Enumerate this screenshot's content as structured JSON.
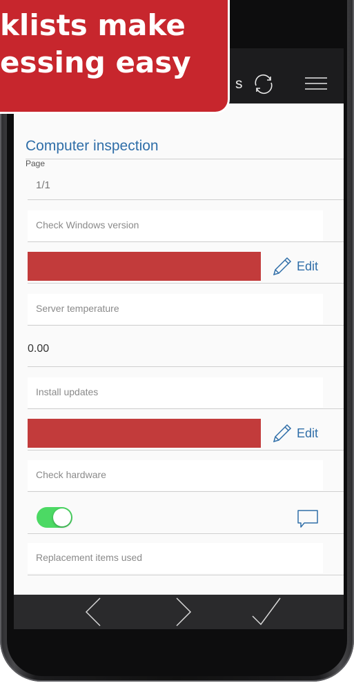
{
  "banner": {
    "line1": "klists make",
    "line2": "essing easy"
  },
  "header": {
    "partial_title": "s",
    "sync_icon": "sync-icon",
    "menu_icon": "hamburger-menu-icon"
  },
  "form": {
    "title": "Computer inspection",
    "page_label": "Page",
    "page_value": "1/1",
    "items": [
      {
        "label": "Check Windows version",
        "edit_label": "Edit",
        "status_color": "#c23b3b"
      },
      {
        "label": "Server temperature",
        "value": "0.00"
      },
      {
        "label": "Install updates",
        "edit_label": "Edit",
        "status_color": "#c23b3b"
      },
      {
        "label": "Check hardware",
        "toggle_on": true,
        "comment_icon": "comment-icon"
      },
      {
        "label": "Replacement items used"
      }
    ]
  },
  "bottom_nav": {
    "prev_icon": "chevron-left-icon",
    "next_icon": "chevron-right-icon",
    "done_icon": "checkmark-icon"
  },
  "colors": {
    "accent": "#2f6ea8",
    "banner": "#c7262d",
    "toggle_on": "#4cd964",
    "header_bg": "#1c1c1e"
  }
}
